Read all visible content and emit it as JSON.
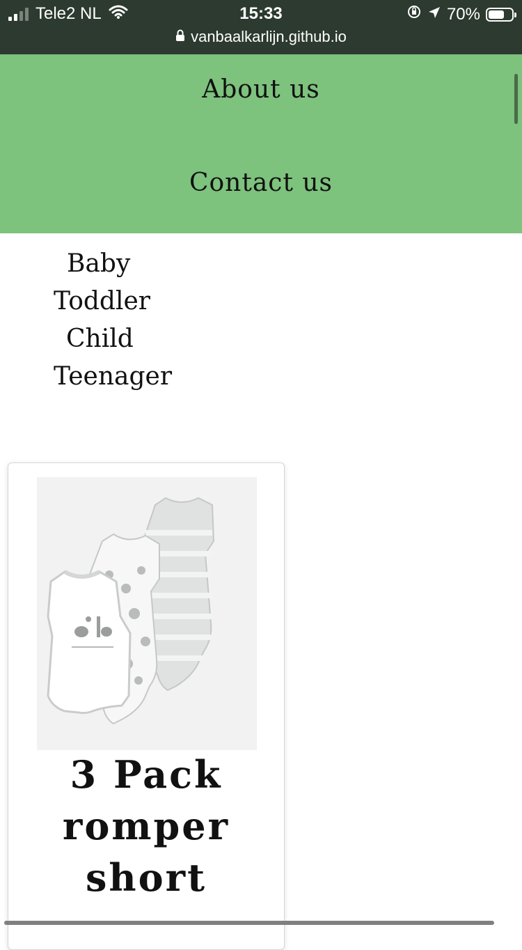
{
  "statusbar": {
    "carrier": "Tele2 NL",
    "time": "15:33",
    "battery_percent": "70%",
    "battery_level": 0.7,
    "url": "vanbaalkarlijn.github.io"
  },
  "nav": {
    "about": "About us",
    "contact": "Contact us",
    "background_color": "#7dc27d"
  },
  "categories": [
    "Baby",
    "Toddler",
    "Child",
    "Teenager"
  ],
  "product": {
    "title_lines": [
      "3 Pack",
      "romper",
      "short"
    ],
    "image": "romper-3-pack"
  }
}
